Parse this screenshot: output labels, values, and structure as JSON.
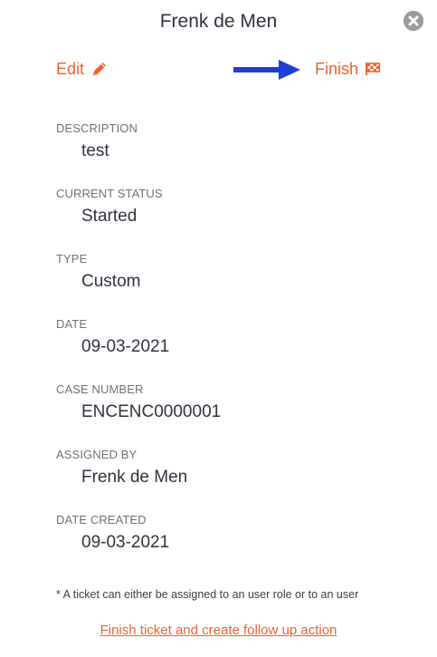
{
  "header": {
    "title": "Frenk de Men",
    "close_icon": "close-circle-icon"
  },
  "actions": {
    "edit_label": "Edit",
    "edit_icon": "pencil-icon",
    "finish_label": "Finish",
    "finish_icon": "checkered-flag-icon",
    "arrow_icon": "arrow-right-icon"
  },
  "colors": {
    "accent": "#f2622e",
    "arrow": "#1d3fd1",
    "close": "#9a9a9a",
    "label": "#6e7179",
    "value": "#2f3340"
  },
  "fields": [
    {
      "label": "DESCRIPTION",
      "value": "test"
    },
    {
      "label": "CURRENT STATUS",
      "value": "Started"
    },
    {
      "label": "TYPE",
      "value": "Custom"
    },
    {
      "label": "DATE",
      "value": "09-03-2021"
    },
    {
      "label": "CASE NUMBER",
      "value": "ENCENC0000001"
    },
    {
      "label": "ASSIGNED BY",
      "value": "Frenk de Men"
    },
    {
      "label": "DATE CREATED",
      "value": "09-03-2021"
    }
  ],
  "footnote": "* A ticket can either be assigned to an user role or to an user",
  "followup_link": "Finish ticket and create follow up action"
}
